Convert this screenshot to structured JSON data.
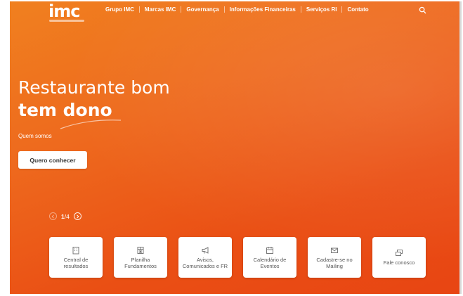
{
  "logo": {
    "text": "imc"
  },
  "nav": {
    "items": [
      {
        "label": "Grupo IMC"
      },
      {
        "label": "Marcas IMC"
      },
      {
        "label": "Governança"
      },
      {
        "label": "Informações Financeiras"
      },
      {
        "label": "Serviços RI"
      },
      {
        "label": "Contato"
      }
    ],
    "search_icon": "search-icon"
  },
  "hero": {
    "title_line1": "Restaurante bom",
    "title_line2": "tem dono",
    "link_text": "Quem somos",
    "cta_label": "Quero conhecer"
  },
  "carousel": {
    "current": "1",
    "separator": "/",
    "total": "4",
    "prev_icon": "chevron-left-icon",
    "next_icon": "chevron-right-icon"
  },
  "cards": [
    {
      "label": "Central de resultados",
      "icon": "building-icon"
    },
    {
      "label": "Planilha Fundamentos",
      "icon": "spreadsheet-icon"
    },
    {
      "label": "Avisos, Comunicados e FR",
      "icon": "megaphone-icon"
    },
    {
      "label": "Calendário de Eventos",
      "icon": "calendar-icon"
    },
    {
      "label": "Cadastre-se no Mailing",
      "icon": "mail-icon"
    },
    {
      "label": "Fale conosco",
      "icon": "chat-icon"
    }
  ],
  "colors": {
    "brand_orange": "#ee6a1e",
    "brand_red_orange": "#e84513",
    "card_bg": "#ffffff"
  }
}
